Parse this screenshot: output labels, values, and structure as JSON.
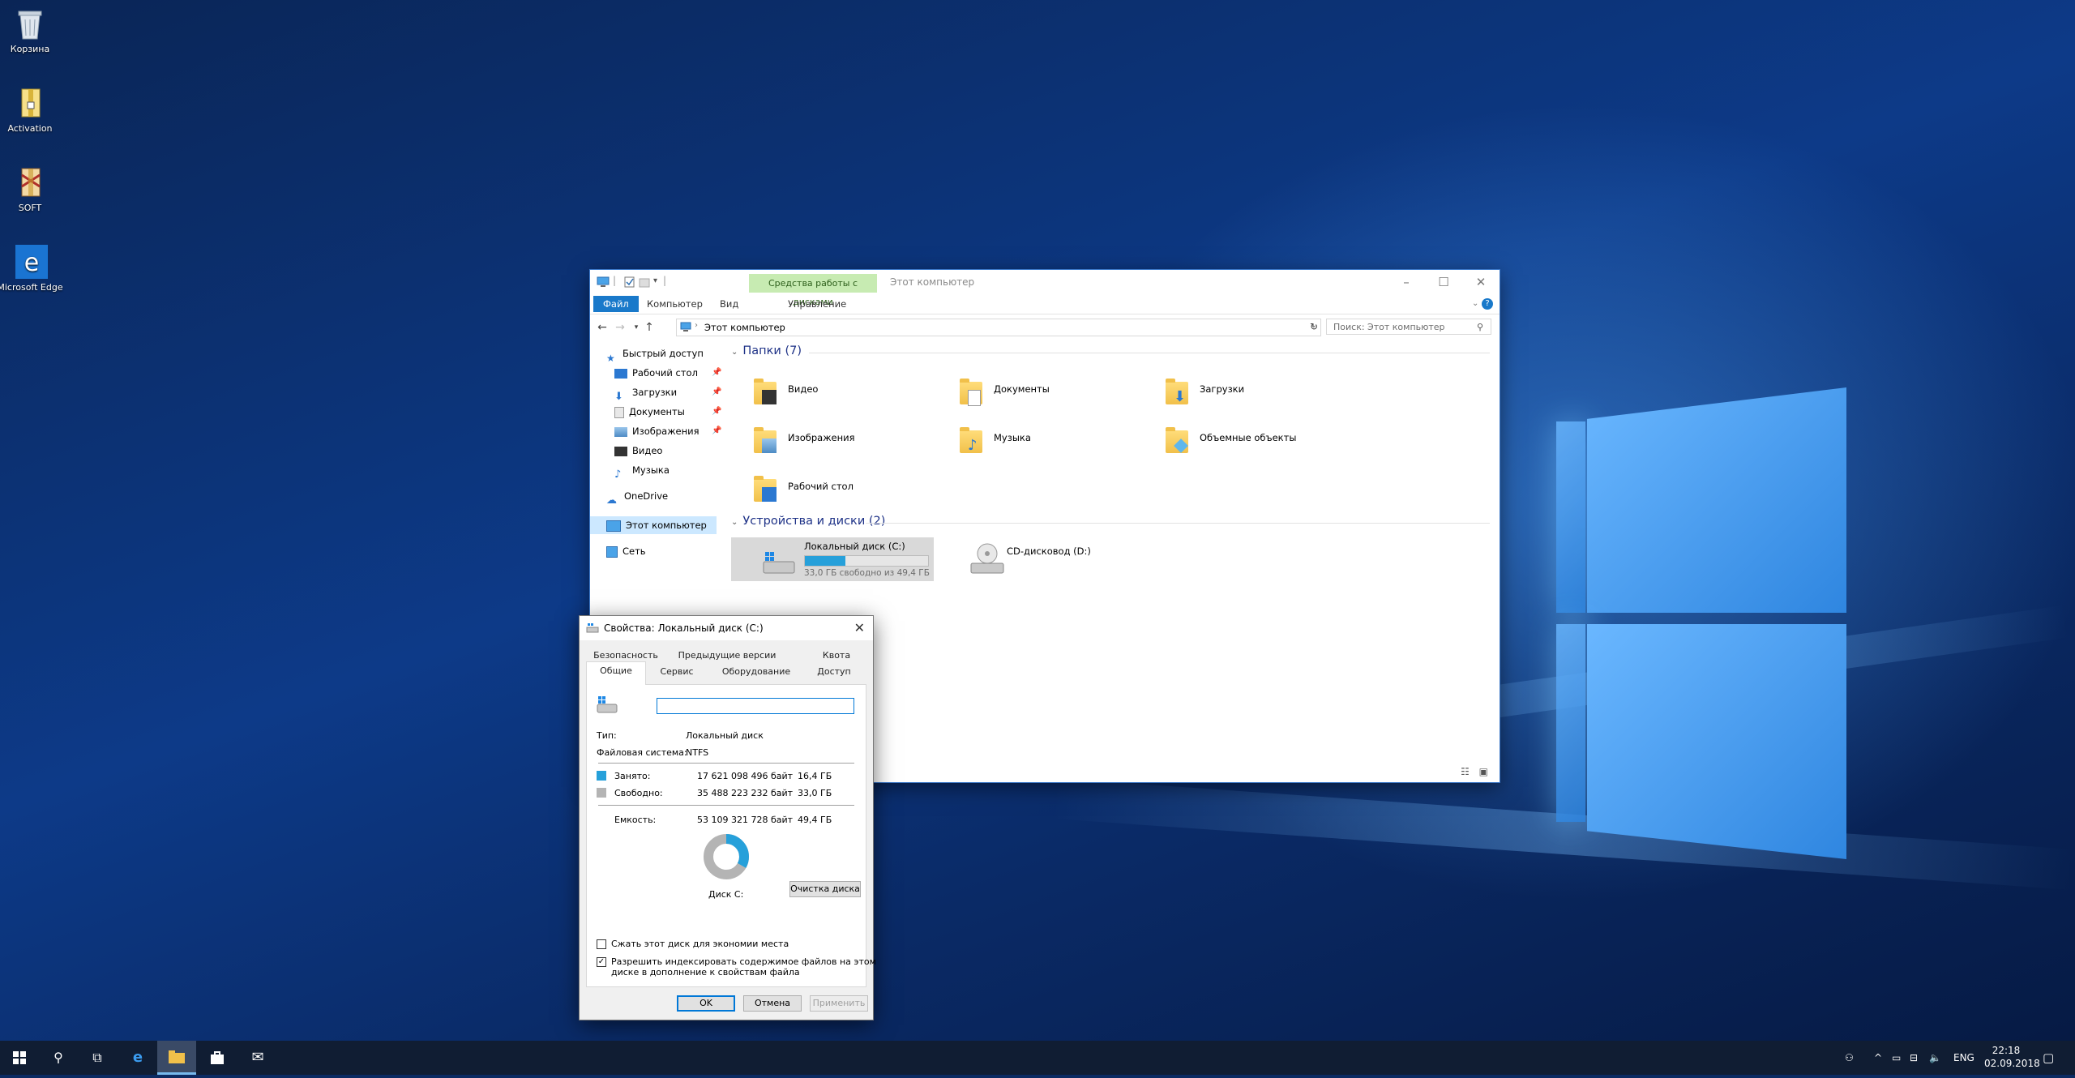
{
  "desktop": {
    "icons": [
      {
        "label": "Корзина",
        "icon": "recycle-bin-icon"
      },
      {
        "label": "Activation",
        "icon": "archive-icon"
      },
      {
        "label": "SOFT",
        "icon": "archive-icon"
      },
      {
        "label": "Microsoft Edge",
        "icon": "edge-icon"
      }
    ]
  },
  "explorer": {
    "contextual_group": "Средства работы с дисками",
    "title": "Этот компьютер",
    "ribbon_tabs": [
      "Файл",
      "Компьютер",
      "Вид",
      "Управление"
    ],
    "address": "Этот компьютер",
    "search_placeholder": "Поиск: Этот компьютер",
    "nav": {
      "quick_access": "Быстрый доступ",
      "items": [
        "Рабочий стол",
        "Загрузки",
        "Документы",
        "Изображения",
        "Видео",
        "Музыка"
      ],
      "onedrive": "OneDrive",
      "this_pc": "Этот компьютер",
      "network": "Сеть"
    },
    "folders_header": "Папки (7)",
    "folders": [
      "Видео",
      "Документы",
      "Загрузки",
      "Изображения",
      "Музыка",
      "Объемные объекты",
      "Рабочий стол"
    ],
    "devices_header": "Устройства и диски (2)",
    "drives": [
      {
        "name": "Локальный диск (C:)",
        "free_text": "33,0 ГБ свободно из 49,4 ГБ",
        "used_fraction": 0.33
      },
      {
        "name": "CD-дисковод (D:)"
      }
    ]
  },
  "dialog": {
    "title": "Свойства: Локальный диск (C:)",
    "tabs_top": [
      "Безопасность",
      "Предыдущие версии",
      "Квота"
    ],
    "tabs_bottom": [
      "Общие",
      "Сервис",
      "Оборудование",
      "Доступ"
    ],
    "label_value": "",
    "type_label": "Тип:",
    "type_value": "Локальный диск",
    "fs_label": "Файловая система:",
    "fs_value": "NTFS",
    "used_label": "Занято:",
    "used_bytes": "17 621 098 496 байт",
    "used_gb": "16,4 ГБ",
    "free_label": "Свободно:",
    "free_bytes": "35 488 223 232 байт",
    "free_gb": "33,0 ГБ",
    "capacity_label": "Емкость:",
    "capacity_bytes": "53 109 321 728 байт",
    "capacity_gb": "49,4 ГБ",
    "disk_label": "Диск C:",
    "cleanup_button": "Очистка диска",
    "compress_label": "Сжать этот диск для экономии места",
    "compress_checked": false,
    "index_label_1": "Разрешить индексировать содержимое файлов на этом",
    "index_label_2": "диске в дополнение к свойствам файла",
    "index_checked": true,
    "ok": "OK",
    "cancel": "Отмена",
    "apply": "Применить",
    "used_color": "#26a0da",
    "free_color": "#b4b4b4"
  },
  "taskbar": {
    "lang": "ENG",
    "time": "22:18",
    "date": "02.09.2018"
  }
}
